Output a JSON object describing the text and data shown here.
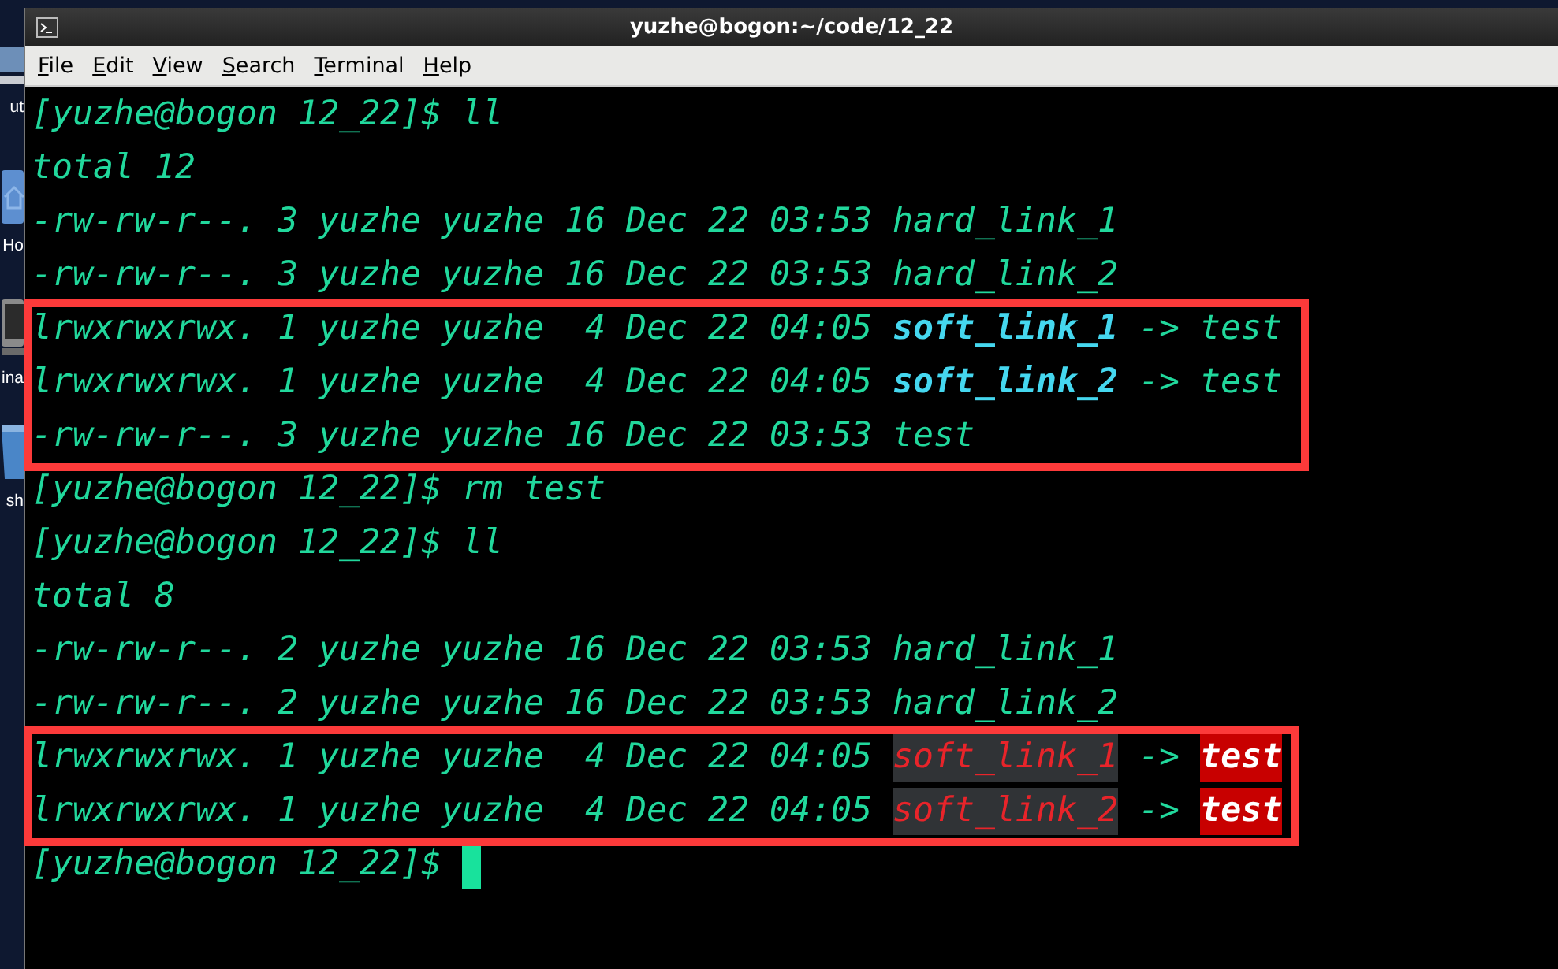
{
  "desktop": {
    "icons": [
      {
        "label": "ut"
      },
      {
        "label": "Ho"
      },
      {
        "label": "ina"
      },
      {
        "label": "sh"
      }
    ]
  },
  "window": {
    "title": "yuzhe@bogon:~/code/12_22"
  },
  "menu": [
    "File",
    "Edit",
    "View",
    "Search",
    "Terminal",
    "Help"
  ],
  "terminal": {
    "lines": [
      [
        {
          "kind": "plain",
          "text": "[yuzhe@bogon 12_22]$ ll"
        }
      ],
      [
        {
          "kind": "plain",
          "text": "total 12"
        }
      ],
      [
        {
          "kind": "plain",
          "text": "-rw-rw-r--. 3 yuzhe yuzhe 16 Dec 22 03:53 hard_link_1"
        }
      ],
      [
        {
          "kind": "plain",
          "text": "-rw-rw-r--. 3 yuzhe yuzhe 16 Dec 22 03:53 hard_link_2"
        }
      ],
      [
        {
          "kind": "plain",
          "text": "lrwxrwxrwx. 1 yuzhe yuzhe  4 Dec 22 04:05 "
        },
        {
          "kind": "link",
          "text": "soft_link_1"
        },
        {
          "kind": "plain",
          "text": " -> test"
        }
      ],
      [
        {
          "kind": "plain",
          "text": "lrwxrwxrwx. 1 yuzhe yuzhe  4 Dec 22 04:05 "
        },
        {
          "kind": "link",
          "text": "soft_link_2"
        },
        {
          "kind": "plain",
          "text": " -> test"
        }
      ],
      [
        {
          "kind": "plain",
          "text": "-rw-rw-r--. 3 yuzhe yuzhe 16 Dec 22 03:53 test"
        }
      ],
      [
        {
          "kind": "plain",
          "text": "[yuzhe@bogon 12_22]$ rm test"
        }
      ],
      [
        {
          "kind": "plain",
          "text": "[yuzhe@bogon 12_22]$ ll"
        }
      ],
      [
        {
          "kind": "plain",
          "text": "total 8"
        }
      ],
      [
        {
          "kind": "plain",
          "text": "-rw-rw-r--. 2 yuzhe yuzhe 16 Dec 22 03:53 hard_link_1"
        }
      ],
      [
        {
          "kind": "plain",
          "text": "-rw-rw-r--. 2 yuzhe yuzhe 16 Dec 22 03:53 hard_link_2"
        }
      ],
      [
        {
          "kind": "plain",
          "text": "lrwxrwxrwx. 1 yuzhe yuzhe  4 Dec 22 04:05 "
        },
        {
          "kind": "broken_link",
          "text": "soft_link_1"
        },
        {
          "kind": "plain",
          "text": " -> "
        },
        {
          "kind": "missing_target",
          "text": "test"
        }
      ],
      [
        {
          "kind": "plain",
          "text": "lrwxrwxrwx. 1 yuzhe yuzhe  4 Dec 22 04:05 "
        },
        {
          "kind": "broken_link",
          "text": "soft_link_2"
        },
        {
          "kind": "plain",
          "text": " -> "
        },
        {
          "kind": "missing_target",
          "text": "test"
        }
      ],
      [
        {
          "kind": "plain",
          "text": "[yuzhe@bogon 12_22]$ "
        },
        {
          "kind": "cursor"
        }
      ]
    ]
  }
}
